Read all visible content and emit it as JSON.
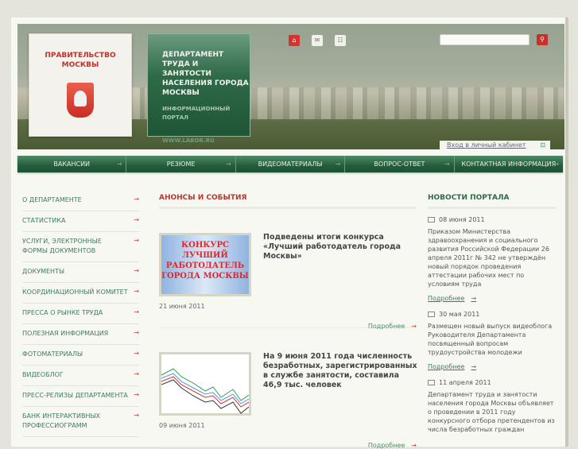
{
  "header": {
    "gov_title": "ПРАВИТЕЛЬСТВО МОСКВЫ",
    "dept_name": "ДЕПАРТАМЕНТ ТРУДА И ЗАНЯТОСТИ НАСЕЛЕНИЯ ГОРОДА МОСКВЫ",
    "portal": "ИНФОРМАЦИОННЫЙ ПОРТАЛ",
    "site": "WWW.LABOR.RU",
    "search_value": "",
    "login": "Вход в личный кабинет"
  },
  "nav": [
    "ВАКАНСИИ",
    "РЕЗЮМЕ",
    "ВИДЕОМАТЕРИАЛЫ",
    "ВОПРОС-ОТВЕТ",
    "КОНТАКТНАЯ ИНФОРМАЦИЯ"
  ],
  "menu": [
    "О ДЕПАРТАМЕНТЕ",
    "СТАТИСТИКА",
    "УСЛУГИ, ЭЛЕКТРОННЫЕ ФОРМЫ ДОКУМЕНТОВ",
    "ДОКУМЕНТЫ",
    "КООРДИНАЦИОННЫЙ КОМИТЕТ",
    "ПРЕССА О РЫНКЕ ТРУДА",
    "ПОЛЕЗНАЯ ИНФОРМАЦИЯ",
    "ФОТОМАТЕРИАЛЫ",
    "ВИДЕОБЛОГ",
    "ПРЕСС-РЕЛИЗЫ ДЕПАРТАМЕНТА",
    "БАНК ИНТЕРАКТИВНЫХ ПРОФЕССИОГРАММ"
  ],
  "events": {
    "title": "АНОНСЫ И СОБЫТИЯ",
    "more": "Подробнее",
    "items": [
      {
        "thumb": "КОНКУРС ЛУЧШИЙ РАБОТОДАТЕЛЬ ГОРОДА МОСКВЫ",
        "title": "Подведены итоги конкурса «Лучший работодатель города Москвы»",
        "date": "21 июня 2011"
      },
      {
        "title": "На 9 июня 2011 года численность безработных, зарегистрированных в службе занятости, составила 46,9 тыс. человек",
        "date": "09 июня 2011"
      }
    ]
  },
  "portal_news": {
    "title": "НОВОСТИ ПОРТАЛА",
    "more": "Подробнее",
    "items": [
      {
        "date": "08 июня 2011",
        "text": "Приказом Министерства здравоохранения и социального развития Российской Федерации 26 апреля 2011г № 342 не утверждён новый порядок проведения аттестации рабочих мест по условиям труда"
      },
      {
        "date": "30 мая 2011",
        "text": "Размещен новый выпуск видеоблога Руководителя Департамента посвященный вопросам трудоустройства молодежи"
      },
      {
        "date": "11 апреля 2011",
        "text": "Департамент труда и занятости населения города Москвы объявляет о проведении в 2011 году конкурсного отбора претендентов из числа безработных граждан"
      }
    ]
  }
}
